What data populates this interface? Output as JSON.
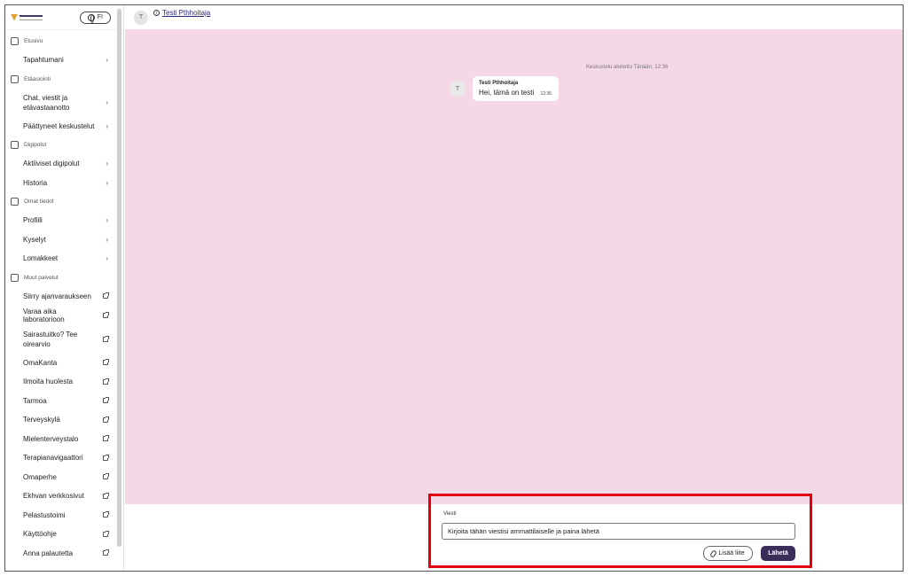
{
  "header": {
    "avatar_initial": "T",
    "contact_name": "Testi Pthhoitaja",
    "language": "FI"
  },
  "sidebar": {
    "sections": [
      {
        "label": "Etusivu",
        "icon": "home-icon",
        "items": [
          {
            "label": "Tapahtumani",
            "marker": "chevron"
          }
        ]
      },
      {
        "label": "Etäasiointi",
        "icon": "chat-bubbles-icon",
        "items": [
          {
            "label": "Chat, viestit ja etävastaanotto",
            "marker": "chevron"
          },
          {
            "label": "Päättyneet keskustelut",
            "marker": "chevron"
          }
        ]
      },
      {
        "label": "Digipolut",
        "icon": "path-icon",
        "items": [
          {
            "label": "Aktiiviset digipolut",
            "marker": "chevron"
          },
          {
            "label": "Historia",
            "marker": "chevron"
          }
        ]
      },
      {
        "label": "Omat tiedot",
        "icon": "user-icon",
        "items": [
          {
            "label": "Profiili",
            "marker": "chevron"
          },
          {
            "label": "Kyselyt",
            "marker": "chevron"
          },
          {
            "label": "Lomakkeet",
            "marker": "chevron"
          }
        ]
      },
      {
        "label": "Muut palvelut",
        "icon": "services-icon",
        "items": [
          {
            "label": "Siirry ajanvaraukseen",
            "marker": "external"
          },
          {
            "label": "Varaa aika laboratorioon",
            "marker": "external"
          },
          {
            "label": "Sairastuitko? Tee oirearvio",
            "marker": "external"
          },
          {
            "label": "OmaKanta",
            "marker": "external"
          },
          {
            "label": "Ilmoita huolesta",
            "marker": "external"
          },
          {
            "label": "Tarmoa",
            "marker": "external"
          },
          {
            "label": "Terveyskylä",
            "marker": "external"
          },
          {
            "label": "Mielenterveystalo",
            "marker": "external"
          },
          {
            "label": "Terapianavigaattori",
            "marker": "external"
          },
          {
            "label": "Omaperhe",
            "marker": "external"
          },
          {
            "label": "Ekhvan verkkosivut",
            "marker": "external"
          },
          {
            "label": "Pelastustoimi",
            "marker": "external"
          },
          {
            "label": "Käyttöohje",
            "marker": "external"
          },
          {
            "label": "Anna palautetta",
            "marker": "external"
          }
        ]
      }
    ]
  },
  "chat": {
    "started_text": "Keskustelu aloitettu Tänään, 12:36",
    "messages": [
      {
        "avatar_initial": "T",
        "sender": "Testi Pthhoitaja",
        "text": "Hei, tämä on testi",
        "time": "12:36"
      }
    ],
    "background_color": "#f5d8e6"
  },
  "composer": {
    "label": "Viesti",
    "value": "Kirjoita tähän viestisi ammattilaiselle ja paina lähetä",
    "attach_label": "Lisää liite",
    "send_label": "Lähetä",
    "send_color": "#3b2d5a",
    "highlight_color": "#e0000e"
  }
}
